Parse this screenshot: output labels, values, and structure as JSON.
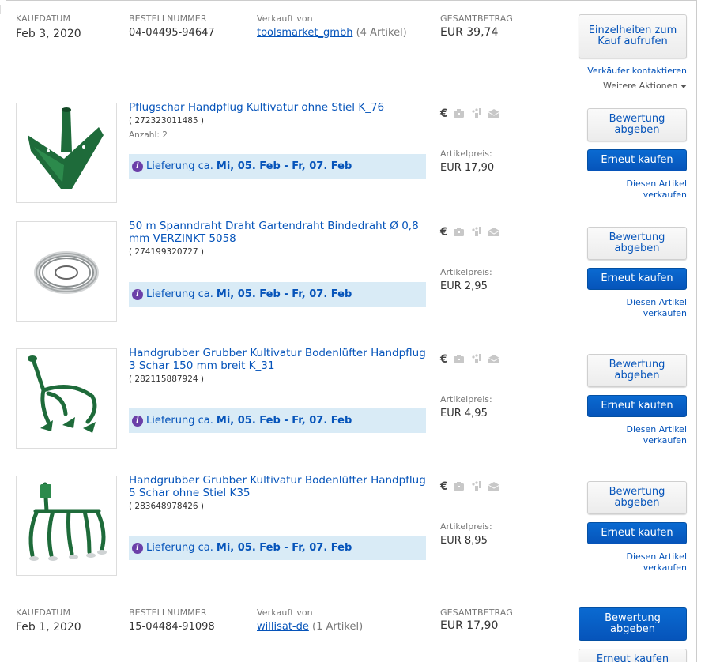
{
  "order1": {
    "date_label": "KAUFDATUM",
    "date": "Feb 3, 2020",
    "number_label": "BESTELLNUMMER",
    "number": "04-04495-94647",
    "seller_label": "Verkauft von",
    "seller": "toolsmarket_gmbh",
    "seller_count": "(4 Artikel)",
    "total_label": "GESAMTBETRAG",
    "total": "EUR 39,74",
    "details_button": "Einzelheiten zum Kauf aufrufen",
    "contact_seller": "Verkäufer kontaktieren",
    "more_actions": "Weitere Aktionen"
  },
  "items": [
    {
      "title": "Pflugschar Handpflug Kultivatur ohne Stiel K_76",
      "item_number": "( 272323011485 )",
      "quantity": "Anzahl: 2",
      "delivery_prefix": "Lieferung ca.",
      "delivery_dates": "Mi, 05. Feb - Fr, 07. Feb",
      "price_label": "Artikelpreis:",
      "price": "EUR 17,90",
      "feedback_button": "Bewertung abgeben",
      "buy_again_button": "Erneut kaufen",
      "sell_link": "Diesen Artikel verkaufen",
      "image": "plow-share-icon"
    },
    {
      "title": "50 m Spanndraht Draht Gartendraht Bindedraht Ø 0,8 mm VERZINKT 5058",
      "item_number": "( 274199320727 )",
      "quantity": "",
      "delivery_prefix": "Lieferung ca.",
      "delivery_dates": "Mi, 05. Feb - Fr, 07. Feb",
      "price_label": "Artikelpreis:",
      "price": "EUR 2,95",
      "feedback_button": "Bewertung abgeben",
      "buy_again_button": "Erneut kaufen",
      "sell_link": "Diesen Artikel verkaufen",
      "image": "wire-coil-icon"
    },
    {
      "title": "Handgrubber Grubber Kultivatur Bodenlüfter Handpflug 3 Schar 150 mm breit K_31",
      "item_number": "( 282115887924 )",
      "quantity": "",
      "delivery_prefix": "Lieferung ca.",
      "delivery_dates": "Mi, 05. Feb - Fr, 07. Feb",
      "price_label": "Artikelpreis:",
      "price": "EUR 4,95",
      "feedback_button": "Bewertung abgeben",
      "buy_again_button": "Erneut kaufen",
      "sell_link": "Diesen Artikel verkaufen",
      "image": "cultivator-3-icon"
    },
    {
      "title": "Handgrubber Grubber Kultivatur Bodenlüfter Handpflug 5 Schar ohne Stiel K35",
      "item_number": "( 283648978426 )",
      "quantity": "",
      "delivery_prefix": "Lieferung ca.",
      "delivery_dates": "Mi, 05. Feb - Fr, 07. Feb",
      "price_label": "Artikelpreis:",
      "price": "EUR 8,95",
      "feedback_button": "Bewertung abgeben",
      "buy_again_button": "Erneut kaufen",
      "sell_link": "Diesen Artikel verkaufen",
      "image": "cultivator-5-icon"
    }
  ],
  "status_icons": [
    "euro-paid-icon",
    "shipped-icon",
    "feedback-icon",
    "message-icon"
  ],
  "euro_symbol": "€",
  "order2": {
    "date_label": "KAUFDATUM",
    "date": "Feb 1, 2020",
    "number_label": "BESTELLNUMMER",
    "number": "15-04484-91098",
    "seller_label": "Verkauft von",
    "seller": "willisat-de",
    "seller_count": "(1 Artikel)",
    "total_label": "GESAMTBETRAG",
    "total": "EUR 17,90",
    "feedback_button": "Bewertung abgeben",
    "buy_again_button": "Erneut kaufen"
  },
  "colors": {
    "link": "#0654ba",
    "primary_button": "#0654ba",
    "delivery_bg": "#d9ebf6",
    "info_icon": "#6b3fa8"
  }
}
